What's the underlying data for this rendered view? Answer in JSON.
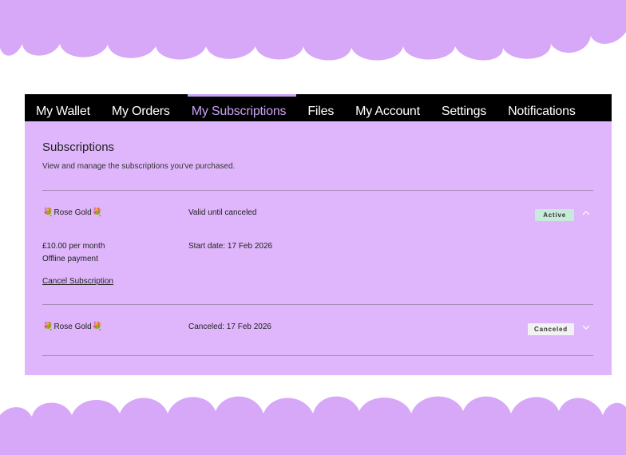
{
  "nav": {
    "tabs": [
      {
        "label": "My Wallet"
      },
      {
        "label": "My Orders"
      },
      {
        "label": "My Subscriptions",
        "active": true
      },
      {
        "label": "Files"
      },
      {
        "label": "My Account"
      },
      {
        "label": "Settings"
      },
      {
        "label": "Notifications"
      }
    ]
  },
  "page": {
    "title": "Subscriptions",
    "subtitle": "View and manage the subscriptions you've purchased."
  },
  "subscriptions": [
    {
      "product_name": "Rose Gold",
      "status_text": "Valid until canceled",
      "badge": "Active",
      "expanded": true,
      "price": "£10.00 per month",
      "payment_method": "Offline payment",
      "start_date": "Start date: 17 Feb 2026",
      "cancel_label": "Cancel Subscription"
    },
    {
      "product_name": "Rose Gold",
      "status_text": "Canceled: 17 Feb 2026",
      "badge": "Canceled",
      "expanded": false
    }
  ],
  "icons": {
    "product_emoji": "💐",
    "expand": "chevron-down-icon",
    "collapse": "chevron-up-icon"
  },
  "colors": {
    "petal": "#d7a8f7",
    "panel": "#dfb6fb",
    "nav_bg": "#000000",
    "active_tab": "#c9a4f4",
    "badge_active": "#c7eadb",
    "badge_canceled": "#f2f2f2"
  }
}
